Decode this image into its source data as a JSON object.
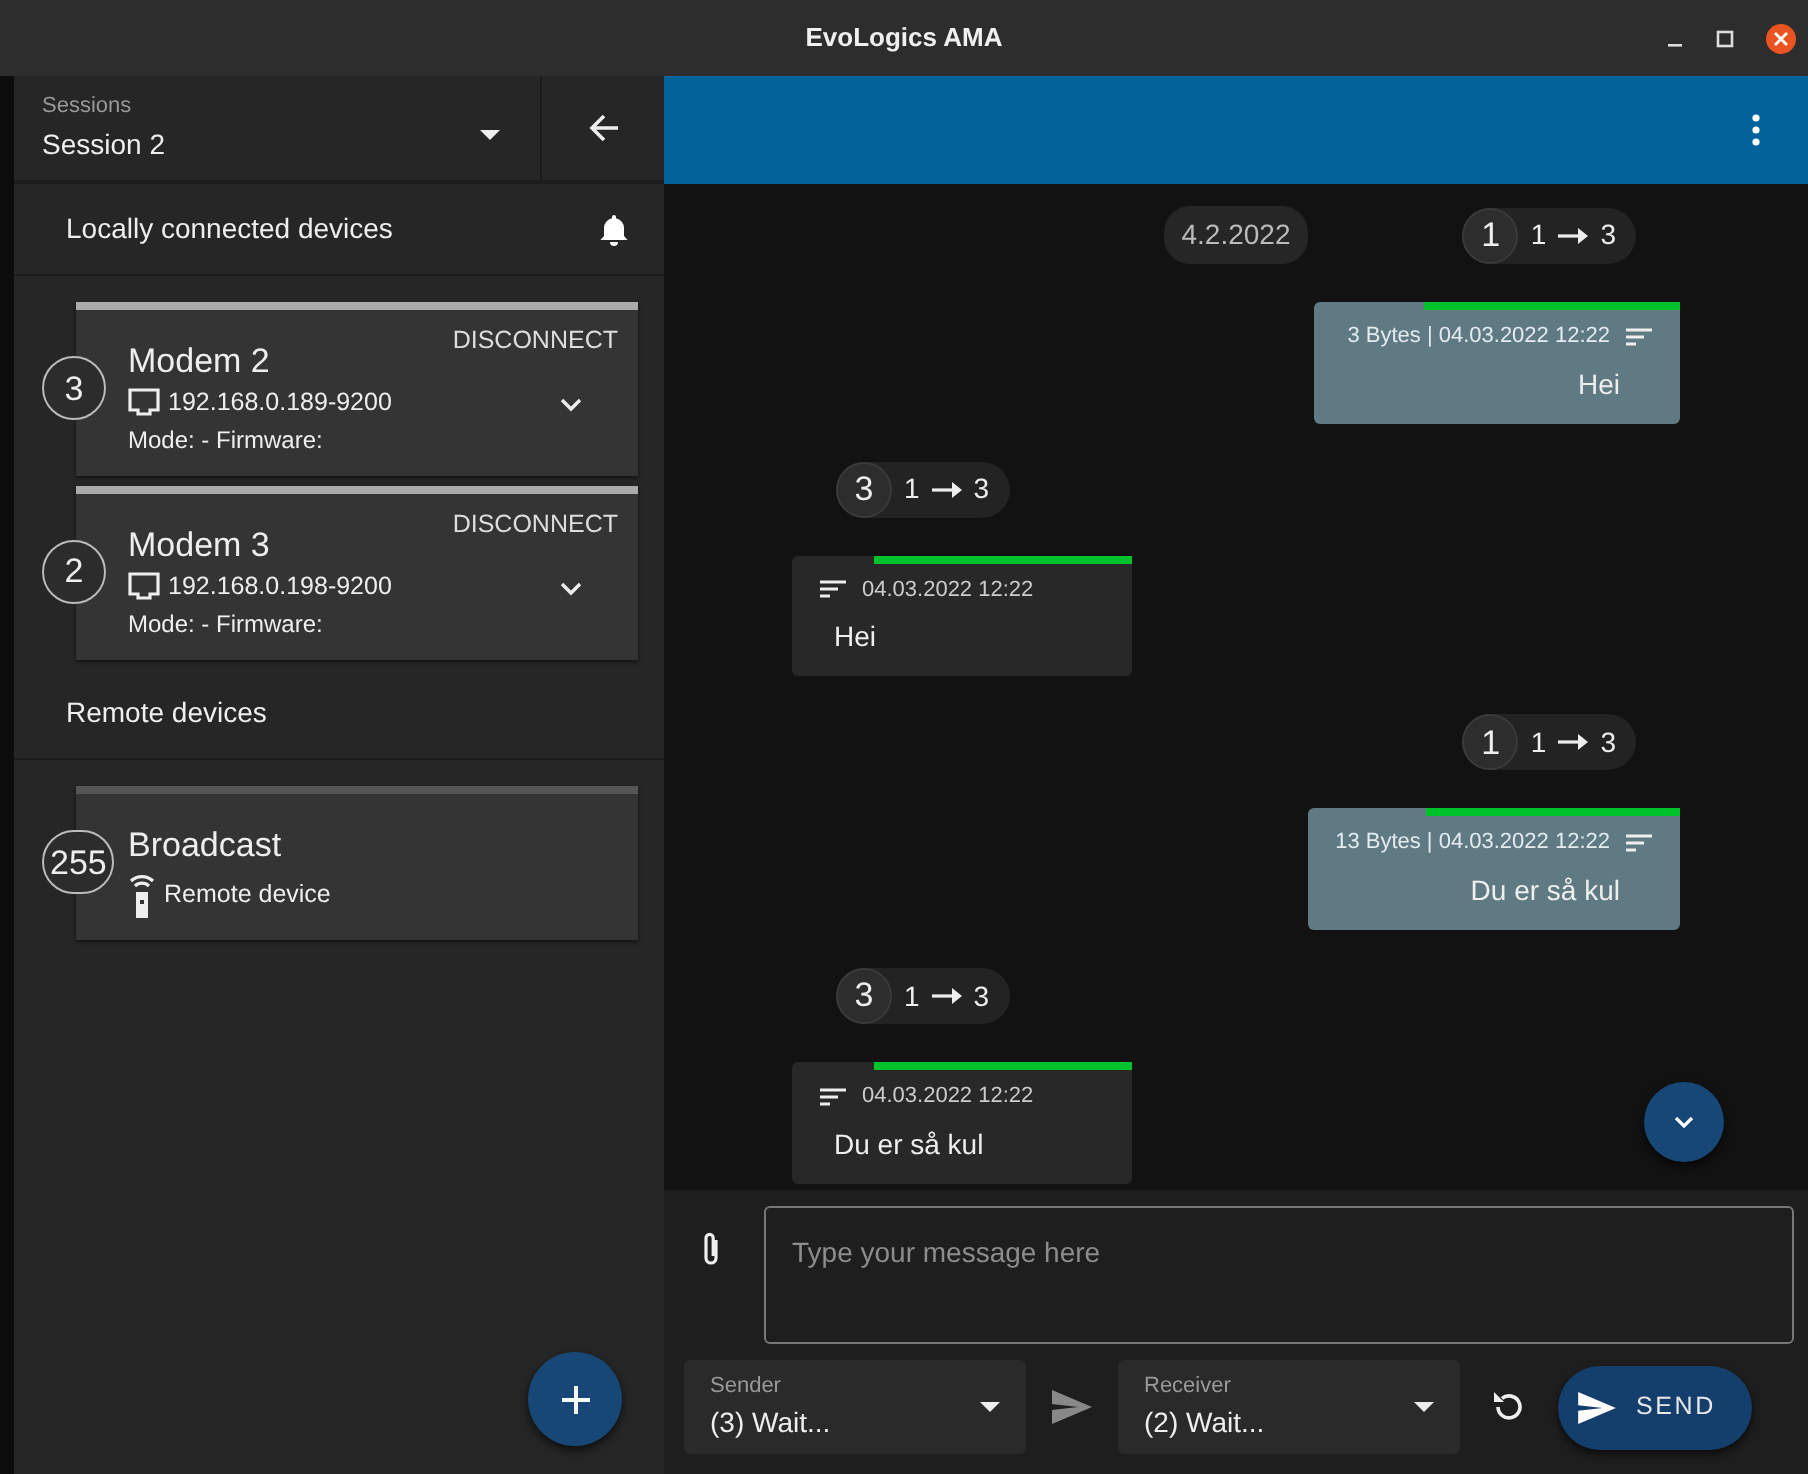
{
  "window": {
    "title": "EvoLogics AMA"
  },
  "session": {
    "label": "Sessions",
    "value": "Session 2"
  },
  "sections": [
    {
      "title": "Locally connected devices",
      "bell": true,
      "devices": [
        {
          "kind": "local",
          "address": "3",
          "name": "Modem 2",
          "endpoint": "192.168.0.189-9200",
          "details": "Mode: - Firmware:",
          "action": "DISCONNECT"
        },
        {
          "kind": "local",
          "address": "2",
          "name": "Modem 3",
          "endpoint": "192.168.0.198-9200",
          "details": "Mode: - Firmware:",
          "action": "DISCONNECT"
        }
      ]
    },
    {
      "title": "Remote devices",
      "bell": false,
      "devices": [
        {
          "kind": "remote",
          "address": "255",
          "name": "Broadcast",
          "endpoint": "Remote device"
        }
      ]
    }
  ],
  "chat": [
    {
      "kind": "date",
      "text": "4.2.2022"
    },
    {
      "kind": "sent_route",
      "node": "1",
      "from": "1",
      "to": "3"
    },
    {
      "kind": "sent_message",
      "meta": "3 Bytes | 04.03.2022 12:22",
      "text": "Hei",
      "level": 0.7
    },
    {
      "kind": "received_route",
      "node": "3",
      "from": "1",
      "to": "3"
    },
    {
      "kind": "received_message",
      "meta": "04.03.2022 12:22",
      "text": "Hei",
      "level": 0.76
    },
    {
      "kind": "sent_route",
      "node": "1",
      "from": "1",
      "to": "3"
    },
    {
      "kind": "sent_message",
      "meta": "13 Bytes | 04.03.2022 12:22",
      "text": "Du er så kul",
      "level": 0.68
    },
    {
      "kind": "received_route",
      "node": "3",
      "from": "1",
      "to": "3"
    },
    {
      "kind": "received_message",
      "meta": "04.03.2022 12:22",
      "text": "Du er så kul",
      "level": 0.76
    }
  ],
  "composer": {
    "placeholder": "Type your message here"
  },
  "sender": {
    "label": "Sender",
    "value": "(3) Wait..."
  },
  "receiver": {
    "label": "Receiver",
    "value": "(2) Wait..."
  },
  "send_button": "SEND"
}
